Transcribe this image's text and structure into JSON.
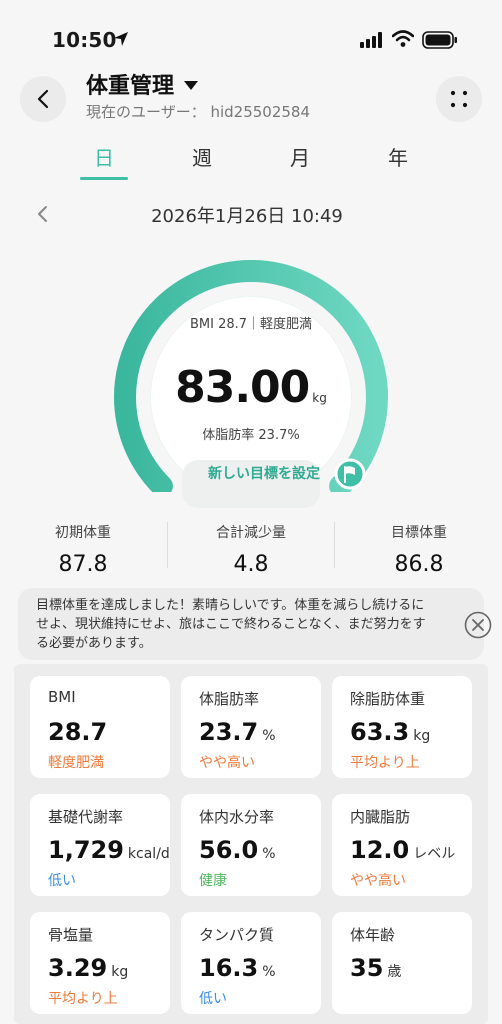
{
  "status_bar": {
    "time": "10:50"
  },
  "header": {
    "title": "体重管理",
    "user_line": "現在のユーザー：  hid25502584"
  },
  "tabs": [
    {
      "label": "日",
      "active": true
    },
    {
      "label": "週",
      "active": false
    },
    {
      "label": "月",
      "active": false
    },
    {
      "label": "年",
      "active": false
    }
  ],
  "date": "2026年1月26日 10:49",
  "gauge": {
    "bmi_text": "BMI 28.7｜軽度肥満",
    "weight": "83.00",
    "unit": "kg",
    "body_fat_text": "体脂肪率 23.7%",
    "progress_fraction": 1.0,
    "goal_button": "新しい目標を設定"
  },
  "stats": [
    {
      "label": "初期体重",
      "value": "87.8"
    },
    {
      "label": "合計減少量",
      "value": "4.8"
    },
    {
      "label": "目標体重",
      "value": "86.8"
    }
  ],
  "banner": {
    "text": "目標体重を達成しました！素晴らしいです。体重を減らし続けるにせよ、現状維持にせよ、旅はここで終わることなく、まだ努力をする必要があります。"
  },
  "metrics": [
    {
      "label": "BMI",
      "value": "28.7",
      "unit": "",
      "status": "軽度肥満",
      "status_color": "#f07a3c"
    },
    {
      "label": "体脂肪率",
      "value": "23.7",
      "unit": "%",
      "status": "やや高い",
      "status_color": "#f07a3c"
    },
    {
      "label": "除脂肪体重",
      "value": "63.3",
      "unit": "kg",
      "status": "平均より上",
      "status_color": "#f07a3c"
    },
    {
      "label": "基礎代謝率",
      "value": "1,729",
      "unit": "kcal/d",
      "status": "低い",
      "status_color": "#3a8de0"
    },
    {
      "label": "体内水分率",
      "value": "56.0",
      "unit": "%",
      "status": "健康",
      "status_color": "#4cb85c"
    },
    {
      "label": "内臓脂肪",
      "value": "12.0",
      "unit": "レベル",
      "status": "やや高い",
      "status_color": "#f07a3c"
    },
    {
      "label": "骨塩量",
      "value": "3.29",
      "unit": "kg",
      "status": "平均より上",
      "status_color": "#f07a3c"
    },
    {
      "label": "タンパク質",
      "value": "16.3",
      "unit": "%",
      "status": "低い",
      "status_color": "#3a8de0"
    },
    {
      "label": "体年齢",
      "value": "35",
      "unit": "歳",
      "status": "",
      "status_color": "#333333"
    }
  ],
  "colors": {
    "accent": "#3fbfa6",
    "warning": "#f07a3c",
    "low": "#3a8de0",
    "good": "#4cb85c"
  }
}
